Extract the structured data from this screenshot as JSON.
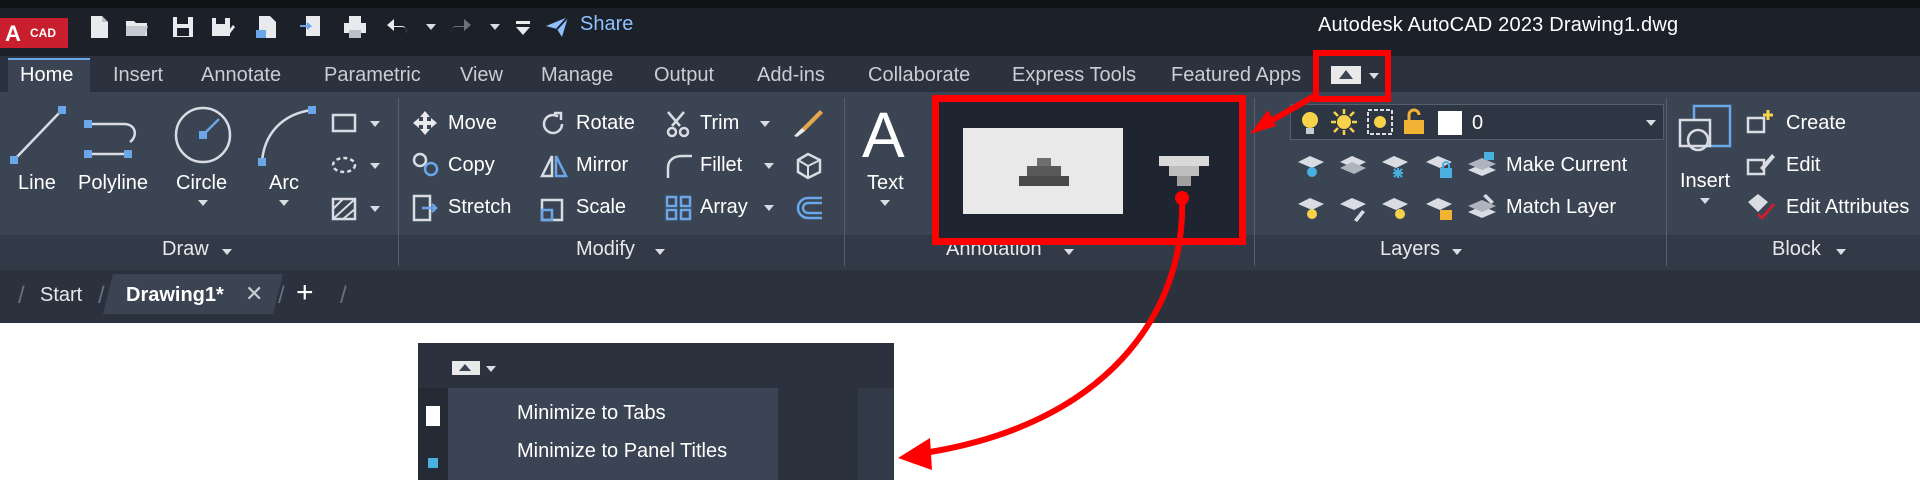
{
  "app": {
    "logo_letter": "A",
    "logo_text": "CAD",
    "window_title": "Autodesk AutoCAD 2023    Drawing1.dwg",
    "share_label": "Share"
  },
  "quick_access_icons": [
    "new-icon",
    "open-icon",
    "save-icon",
    "save-as-icon",
    "open-web-icon",
    "save-web-icon",
    "plot-icon",
    "undo-icon",
    "redo-icon",
    "customize-icon"
  ],
  "ribbon_tabs": [
    "Home",
    "Insert",
    "Annotate",
    "Parametric",
    "View",
    "Manage",
    "Output",
    "Add-ins",
    "Collaborate",
    "Express Tools",
    "Featured Apps"
  ],
  "draw": {
    "title": "Draw",
    "tools": [
      "Line",
      "Polyline",
      "Circle",
      "Arc"
    ]
  },
  "modify": {
    "title": "Modify",
    "col1": [
      "Move",
      "Copy",
      "Stretch"
    ],
    "col2": [
      "Rotate",
      "Mirror",
      "Scale"
    ],
    "col3": [
      "Trim",
      "Fillet",
      "Array"
    ]
  },
  "annotation": {
    "title": "Annotation",
    "text_letter": "A",
    "text_label": "Text"
  },
  "layers": {
    "title": "Layers",
    "current_layer": "0",
    "make_current": "Make Current",
    "match_layer": "Match Layer"
  },
  "block": {
    "title": "Block",
    "insert": "Insert",
    "create": "Create",
    "edit": "Edit",
    "edit_attributes": "Edit Attributes"
  },
  "doc_tabs": {
    "start": "Start",
    "active": "Drawing1*",
    "close_glyph": "✕",
    "new_glyph": "+"
  },
  "popup_menu": {
    "items": [
      "Minimize to Tabs",
      "Minimize to Panel Titles"
    ]
  },
  "colors": {
    "highlight": "#ff0000",
    "ribbon_bg": "#3b4453",
    "titlebar_bg": "#1b2029",
    "accent_blue": "#8fc1ff"
  }
}
